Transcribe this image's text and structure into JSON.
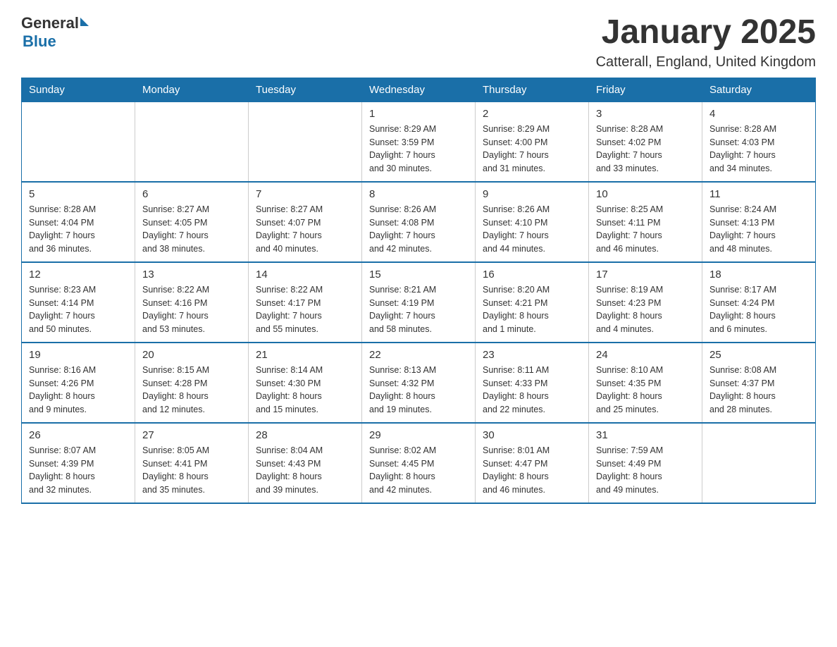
{
  "logo": {
    "text_general": "General",
    "text_blue": "Blue"
  },
  "title": "January 2025",
  "location": "Catterall, England, United Kingdom",
  "days_of_week": [
    "Sunday",
    "Monday",
    "Tuesday",
    "Wednesday",
    "Thursday",
    "Friday",
    "Saturday"
  ],
  "weeks": [
    [
      {
        "day": "",
        "info": ""
      },
      {
        "day": "",
        "info": ""
      },
      {
        "day": "",
        "info": ""
      },
      {
        "day": "1",
        "info": "Sunrise: 8:29 AM\nSunset: 3:59 PM\nDaylight: 7 hours\nand 30 minutes."
      },
      {
        "day": "2",
        "info": "Sunrise: 8:29 AM\nSunset: 4:00 PM\nDaylight: 7 hours\nand 31 minutes."
      },
      {
        "day": "3",
        "info": "Sunrise: 8:28 AM\nSunset: 4:02 PM\nDaylight: 7 hours\nand 33 minutes."
      },
      {
        "day": "4",
        "info": "Sunrise: 8:28 AM\nSunset: 4:03 PM\nDaylight: 7 hours\nand 34 minutes."
      }
    ],
    [
      {
        "day": "5",
        "info": "Sunrise: 8:28 AM\nSunset: 4:04 PM\nDaylight: 7 hours\nand 36 minutes."
      },
      {
        "day": "6",
        "info": "Sunrise: 8:27 AM\nSunset: 4:05 PM\nDaylight: 7 hours\nand 38 minutes."
      },
      {
        "day": "7",
        "info": "Sunrise: 8:27 AM\nSunset: 4:07 PM\nDaylight: 7 hours\nand 40 minutes."
      },
      {
        "day": "8",
        "info": "Sunrise: 8:26 AM\nSunset: 4:08 PM\nDaylight: 7 hours\nand 42 minutes."
      },
      {
        "day": "9",
        "info": "Sunrise: 8:26 AM\nSunset: 4:10 PM\nDaylight: 7 hours\nand 44 minutes."
      },
      {
        "day": "10",
        "info": "Sunrise: 8:25 AM\nSunset: 4:11 PM\nDaylight: 7 hours\nand 46 minutes."
      },
      {
        "day": "11",
        "info": "Sunrise: 8:24 AM\nSunset: 4:13 PM\nDaylight: 7 hours\nand 48 minutes."
      }
    ],
    [
      {
        "day": "12",
        "info": "Sunrise: 8:23 AM\nSunset: 4:14 PM\nDaylight: 7 hours\nand 50 minutes."
      },
      {
        "day": "13",
        "info": "Sunrise: 8:22 AM\nSunset: 4:16 PM\nDaylight: 7 hours\nand 53 minutes."
      },
      {
        "day": "14",
        "info": "Sunrise: 8:22 AM\nSunset: 4:17 PM\nDaylight: 7 hours\nand 55 minutes."
      },
      {
        "day": "15",
        "info": "Sunrise: 8:21 AM\nSunset: 4:19 PM\nDaylight: 7 hours\nand 58 minutes."
      },
      {
        "day": "16",
        "info": "Sunrise: 8:20 AM\nSunset: 4:21 PM\nDaylight: 8 hours\nand 1 minute."
      },
      {
        "day": "17",
        "info": "Sunrise: 8:19 AM\nSunset: 4:23 PM\nDaylight: 8 hours\nand 4 minutes."
      },
      {
        "day": "18",
        "info": "Sunrise: 8:17 AM\nSunset: 4:24 PM\nDaylight: 8 hours\nand 6 minutes."
      }
    ],
    [
      {
        "day": "19",
        "info": "Sunrise: 8:16 AM\nSunset: 4:26 PM\nDaylight: 8 hours\nand 9 minutes."
      },
      {
        "day": "20",
        "info": "Sunrise: 8:15 AM\nSunset: 4:28 PM\nDaylight: 8 hours\nand 12 minutes."
      },
      {
        "day": "21",
        "info": "Sunrise: 8:14 AM\nSunset: 4:30 PM\nDaylight: 8 hours\nand 15 minutes."
      },
      {
        "day": "22",
        "info": "Sunrise: 8:13 AM\nSunset: 4:32 PM\nDaylight: 8 hours\nand 19 minutes."
      },
      {
        "day": "23",
        "info": "Sunrise: 8:11 AM\nSunset: 4:33 PM\nDaylight: 8 hours\nand 22 minutes."
      },
      {
        "day": "24",
        "info": "Sunrise: 8:10 AM\nSunset: 4:35 PM\nDaylight: 8 hours\nand 25 minutes."
      },
      {
        "day": "25",
        "info": "Sunrise: 8:08 AM\nSunset: 4:37 PM\nDaylight: 8 hours\nand 28 minutes."
      }
    ],
    [
      {
        "day": "26",
        "info": "Sunrise: 8:07 AM\nSunset: 4:39 PM\nDaylight: 8 hours\nand 32 minutes."
      },
      {
        "day": "27",
        "info": "Sunrise: 8:05 AM\nSunset: 4:41 PM\nDaylight: 8 hours\nand 35 minutes."
      },
      {
        "day": "28",
        "info": "Sunrise: 8:04 AM\nSunset: 4:43 PM\nDaylight: 8 hours\nand 39 minutes."
      },
      {
        "day": "29",
        "info": "Sunrise: 8:02 AM\nSunset: 4:45 PM\nDaylight: 8 hours\nand 42 minutes."
      },
      {
        "day": "30",
        "info": "Sunrise: 8:01 AM\nSunset: 4:47 PM\nDaylight: 8 hours\nand 46 minutes."
      },
      {
        "day": "31",
        "info": "Sunrise: 7:59 AM\nSunset: 4:49 PM\nDaylight: 8 hours\nand 49 minutes."
      },
      {
        "day": "",
        "info": ""
      }
    ]
  ]
}
